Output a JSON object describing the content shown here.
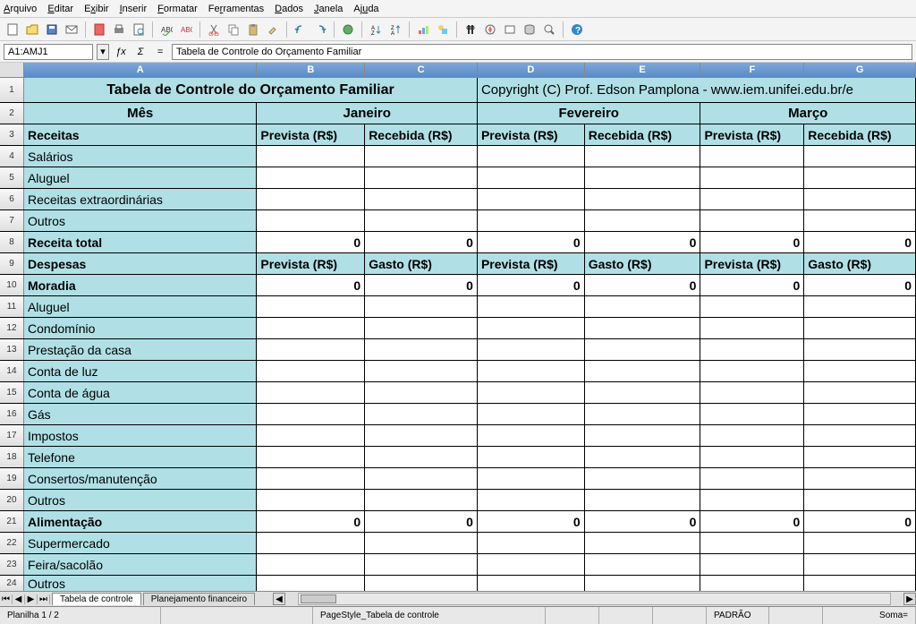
{
  "menu": [
    "Arquivo",
    "Editar",
    "Exibir",
    "Inserir",
    "Formatar",
    "Ferramentas",
    "Dados",
    "Janela",
    "Ajuda"
  ],
  "cellref": "A1:AMJ1",
  "formula": "Tabela de Controle do Orçamento Familiar",
  "columns": [
    "A",
    "B",
    "C",
    "D",
    "E",
    "F",
    "G"
  ],
  "title": "Tabela de Controle do Orçamento Familiar",
  "copyright": "Copyright (C) Prof. Edson Pamplona - www.iem.unifei.edu.br/e",
  "row2": {
    "mes": "Mês",
    "jan": "Janeiro",
    "fev": "Fevereiro",
    "mar": "Março"
  },
  "row3": {
    "label": "Receitas",
    "prev": "Prevista (R$)",
    "rec": "Recebida (R$)"
  },
  "r4": "Salários",
  "r5": "Aluguel",
  "r6": "Receitas extraordinárias",
  "r7": "Outros",
  "r8": {
    "label": "Receita total",
    "v": "0"
  },
  "r9": {
    "label": "Despesas",
    "prev": "Prevista (R$)",
    "gasto": "Gasto (R$)"
  },
  "r10": {
    "label": "Moradia",
    "v": "0"
  },
  "r11": "Aluguel",
  "r12": "Condomínio",
  "r13": "Prestação da casa",
  "r14": "Conta de luz",
  "r15": "Conta de água",
  "r16": "Gás",
  "r17": "Impostos",
  "r18": "Telefone",
  "r19": "Consertos/manutenção",
  "r20": "Outros",
  "r21": {
    "label": "Alimentação",
    "v": "0"
  },
  "r22": "Supermercado",
  "r23": "Feira/sacolão",
  "r24": "Outros",
  "tabs": [
    "Tabela de controle",
    "Planejamento financeiro"
  ],
  "status": {
    "sheet": "Planilha 1 / 2",
    "style": "PageStyle_Tabela de controle",
    "mode": "PADRÃO",
    "sum": "Soma="
  }
}
